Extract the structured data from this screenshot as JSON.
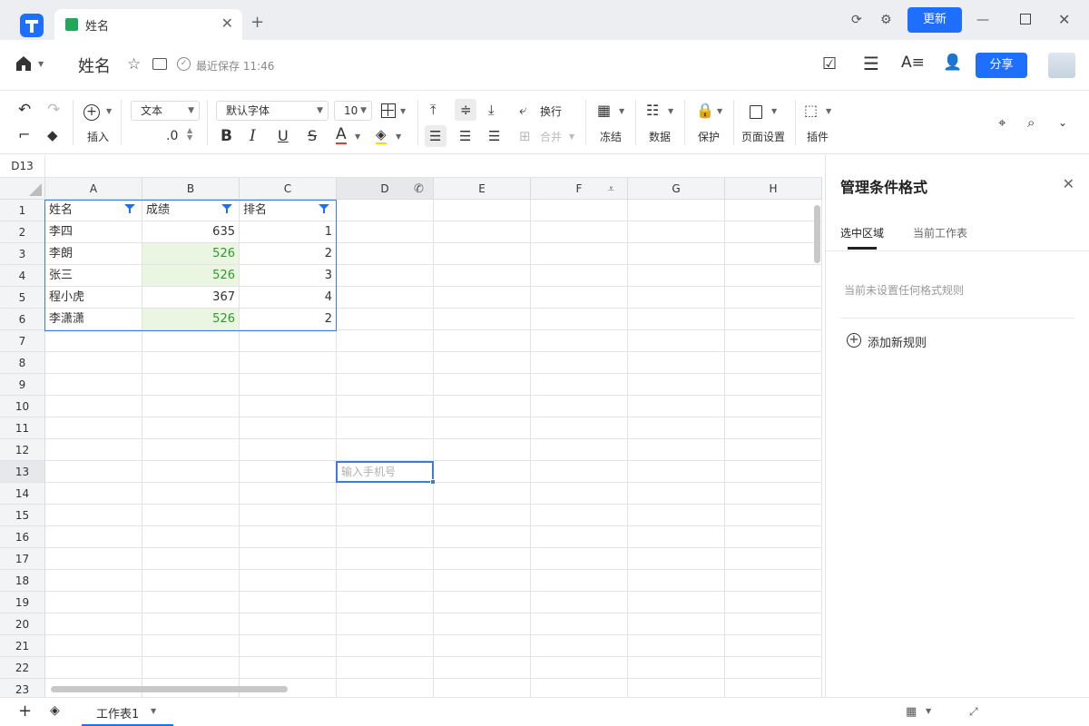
{
  "tab": {
    "title": "姓名"
  },
  "window": {
    "update_label": "更新"
  },
  "doc": {
    "title": "姓名",
    "save_status": "最近保存 11:46",
    "share_label": "分享"
  },
  "toolbar": {
    "insert_label": "插入",
    "format_value": "文本",
    "decimal_value": ".0",
    "font_value": "默认字体",
    "size_value": "10",
    "wrap_label": "换行",
    "merge_label": "合并",
    "freeze_label": "冻结",
    "data_label": "数据",
    "protect_label": "保护",
    "page_setup_label": "页面设置",
    "plugin_label": "插件",
    "bold": "B",
    "italic": "I",
    "underline": "U",
    "strike": "S",
    "font_color": "A"
  },
  "namebox": "D13",
  "columns": [
    "A",
    "B",
    "C",
    "D",
    "E",
    "F",
    "G",
    "H"
  ],
  "rows": [
    "1",
    "2",
    "3",
    "4",
    "5",
    "6",
    "7",
    "8",
    "9",
    "10",
    "11",
    "12",
    "13",
    "14",
    "15",
    "16",
    "17",
    "18",
    "19",
    "20",
    "21",
    "22",
    "23"
  ],
  "table": {
    "headers": [
      "姓名",
      "成绩",
      "排名"
    ],
    "data": [
      [
        "李四",
        "635",
        "1"
      ],
      [
        "李朗",
        "526",
        "2"
      ],
      [
        "张三",
        "526",
        "3"
      ],
      [
        "程小虎",
        "367",
        "4"
      ],
      [
        "李潇潇",
        "526",
        "2"
      ]
    ],
    "highlight_color": "#eaf5e2"
  },
  "active_cell": {
    "placeholder": "输入手机号"
  },
  "panel": {
    "title": "管理条件格式",
    "tabs": [
      "选中区域",
      "当前工作表"
    ],
    "empty_text": "当前未设置任何格式规则",
    "add_rule_label": "添加新规则"
  },
  "sheets": {
    "active": "工作表1"
  },
  "accent_color": "#1f6fff"
}
